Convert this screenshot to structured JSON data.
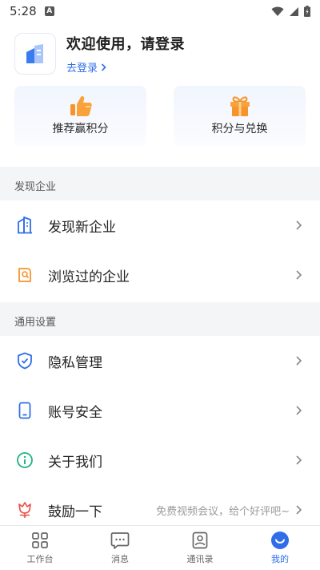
{
  "status_bar": {
    "time": "5:28",
    "notif_glyph": "A"
  },
  "profile": {
    "title": "欢迎使用，请登录",
    "login_label": "去登录"
  },
  "cards": [
    {
      "label": "推荐赢积分",
      "icon": "thumbs-up-icon"
    },
    {
      "label": "积分与兑换",
      "icon": "gift-icon"
    }
  ],
  "sections": [
    {
      "title": "发现企业",
      "items": [
        {
          "label": "发现新企业",
          "icon": "building-icon"
        },
        {
          "label": "浏览过的企业",
          "icon": "browse-history-icon"
        }
      ]
    },
    {
      "title": "通用设置",
      "items": [
        {
          "label": "隐私管理",
          "icon": "shield-icon"
        },
        {
          "label": "账号安全",
          "icon": "phone-icon"
        },
        {
          "label": "关于我们",
          "icon": "info-icon"
        },
        {
          "label": "鼓励一下",
          "icon": "flower-icon",
          "hint": "免费视频会议，给个好评吧~"
        }
      ]
    }
  ],
  "tabbar": [
    {
      "label": "工作台",
      "icon": "grid-icon",
      "active": false
    },
    {
      "label": "消息",
      "icon": "chat-icon",
      "active": false
    },
    {
      "label": "通讯录",
      "icon": "contacts-icon",
      "active": false
    },
    {
      "label": "我的",
      "icon": "smile-icon",
      "active": true
    }
  ],
  "colors": {
    "accent": "#2f6ee8",
    "orange": "#f6932b",
    "green": "#1fb37e",
    "red": "#e8524a"
  }
}
